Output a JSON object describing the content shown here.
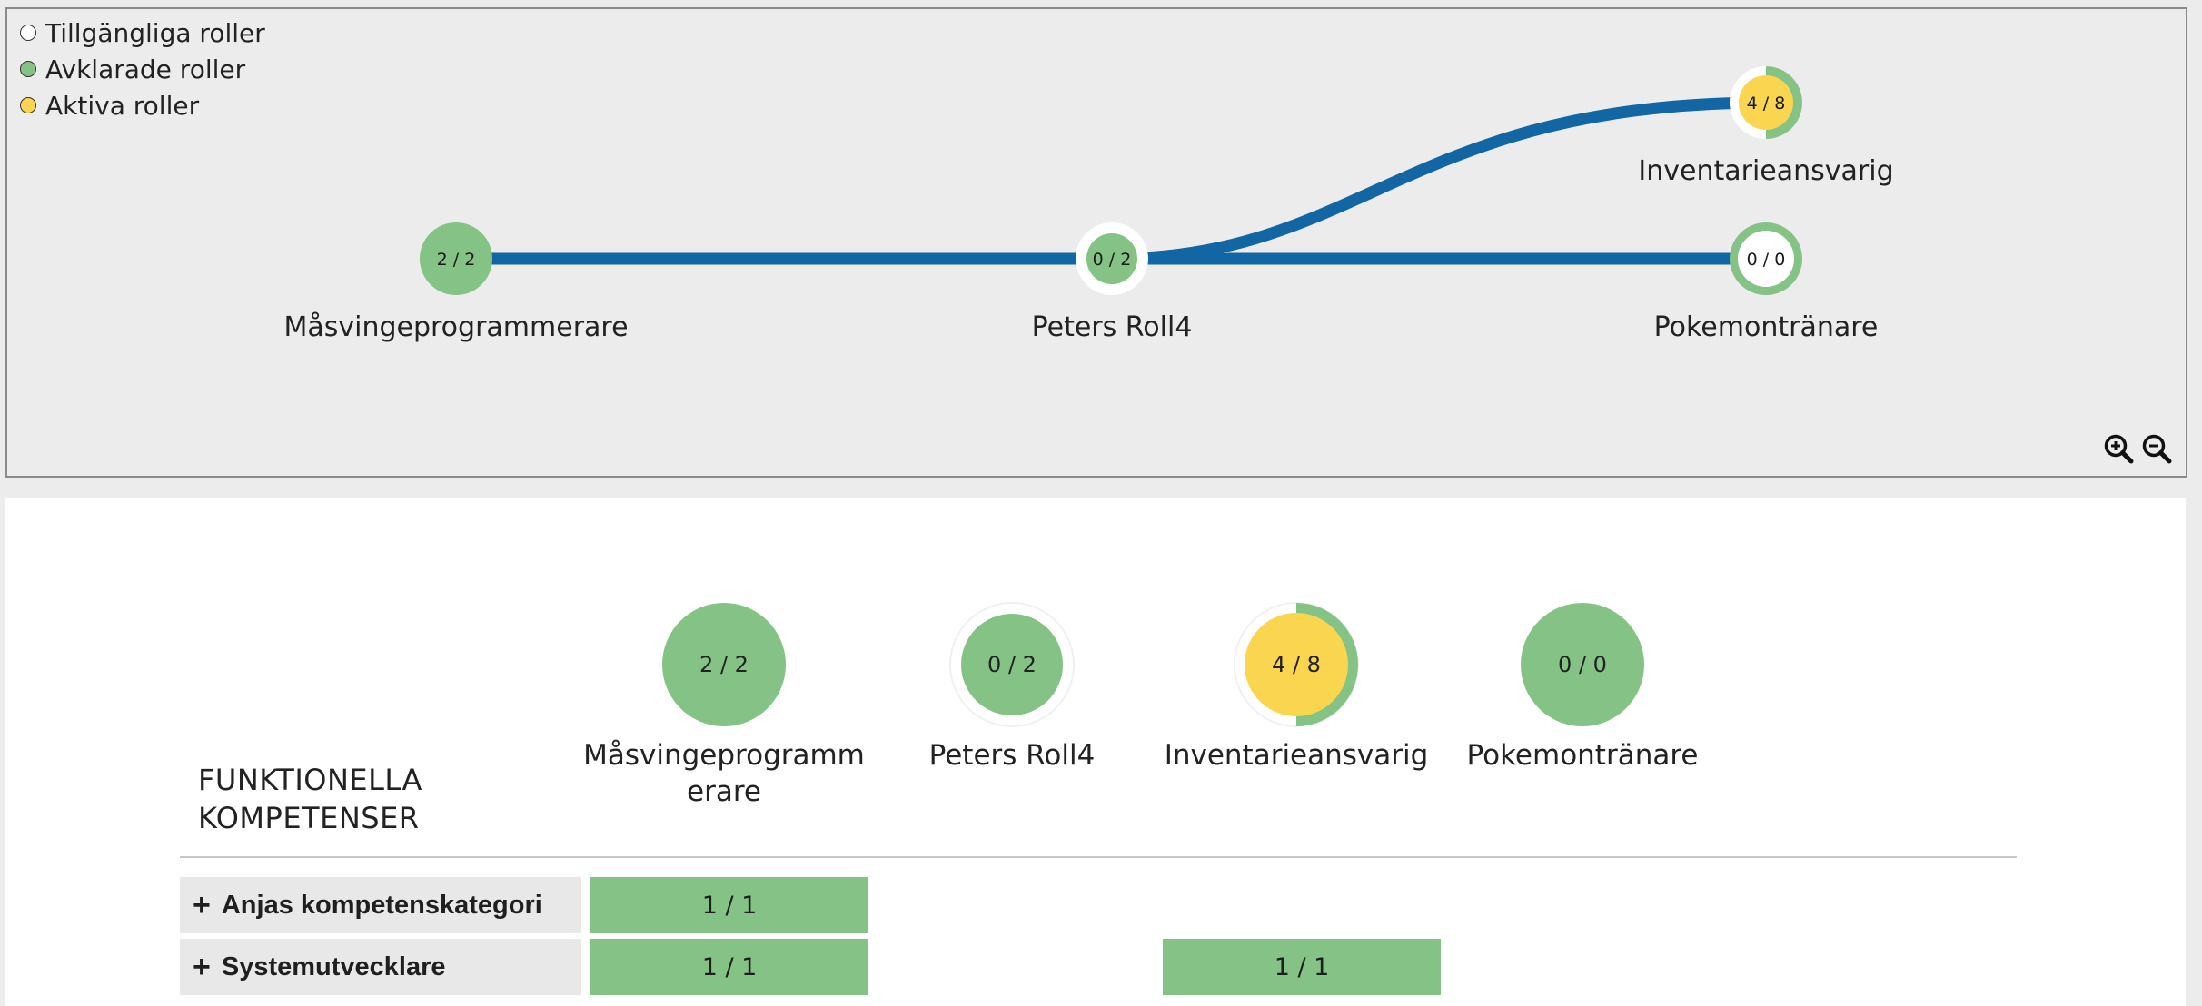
{
  "colors": {
    "available": "#ffffff",
    "completed": "#84c286",
    "active": "#f9d550",
    "path": "#1266a4"
  },
  "legend": [
    {
      "label": "Tillgängliga roller",
      "color": "#ffffff"
    },
    {
      "label": "Avklarade roller",
      "color": "#84c286"
    },
    {
      "label": "Aktiva roller",
      "color": "#f9d550"
    }
  ],
  "map": {
    "nodes": [
      {
        "name": "Måsvingeprogrammerare",
        "count": "2 / 2",
        "state": "completed"
      },
      {
        "name": "Peters Roll4",
        "count": "0 / 2",
        "state": "completed-partial"
      },
      {
        "name": "Inventarieansvarig",
        "count": "4 / 8",
        "state": "active"
      },
      {
        "name": "Pokemontränare",
        "count": "0 / 0",
        "state": "available"
      }
    ],
    "zoom_in_icon": "zoom-in-icon",
    "zoom_out_icon": "zoom-out-icon"
  },
  "competence": {
    "heading_line1": "FUNKTIONELLA",
    "heading_line2": "KOMPETENSER",
    "roles": [
      {
        "label_line1": "Måsvingeprogramm",
        "label_line2": "erare",
        "count": "2 / 2",
        "state": "completed"
      },
      {
        "label_line1": "Peters Roll4",
        "label_line2": "",
        "count": "0 / 2",
        "state": "completed-partial"
      },
      {
        "label_line1": "Inventarieansvarig",
        "label_line2": "",
        "count": "4 / 8",
        "state": "active"
      },
      {
        "label_line1": "Pokemontränare",
        "label_line2": "",
        "count": "0 / 0",
        "state": "completed"
      }
    ],
    "rows": [
      {
        "label": "Anjas kompetenskategori",
        "cells": [
          "1 / 1",
          "",
          "",
          ""
        ]
      },
      {
        "label": "Systemutvecklare",
        "cells": [
          "1 / 1",
          "",
          "1 / 1",
          ""
        ]
      }
    ]
  }
}
